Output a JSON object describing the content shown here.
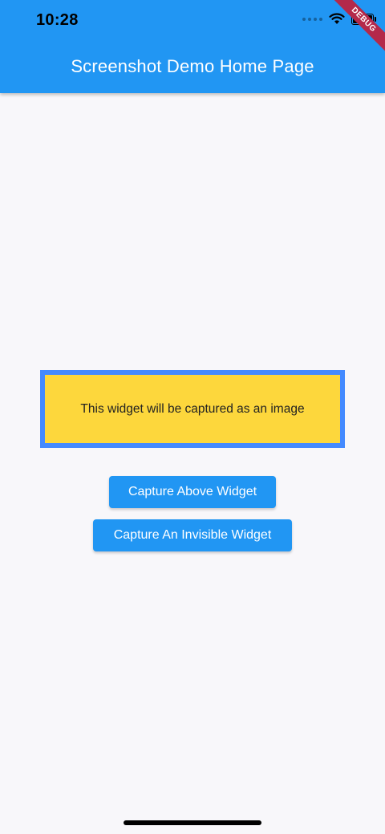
{
  "status_bar": {
    "time": "10:28"
  },
  "appbar": {
    "title": "Screenshot Demo Home Page",
    "color": "#2196f3"
  },
  "debug_banner": "DEBUG",
  "capture_box": {
    "text": "This widget will be captured as an image",
    "border_color": "#448aff",
    "fill_color": "#fdd73c"
  },
  "buttons": {
    "capture_above": "Capture Above Widget",
    "capture_invisible": "Capture An Invisible Widget"
  },
  "icons": [
    "cellular-signal-icon",
    "wifi-icon",
    "battery-icon"
  ]
}
